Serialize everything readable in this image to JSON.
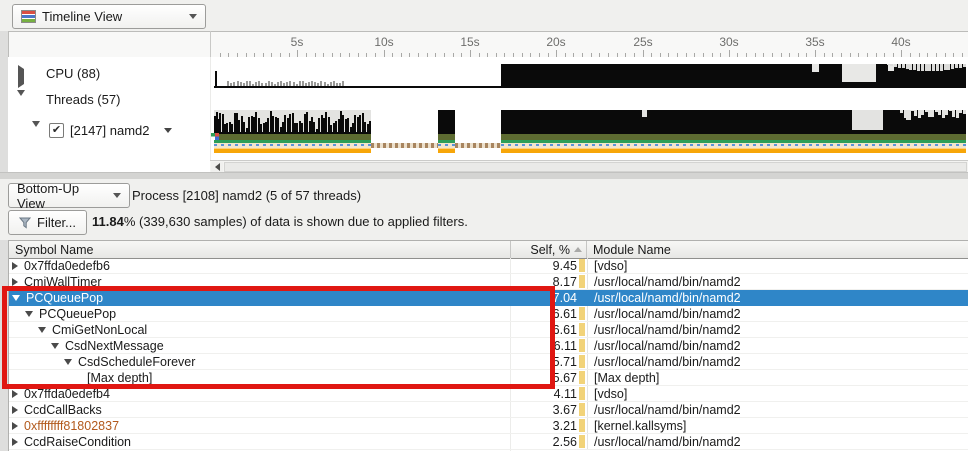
{
  "toolbar": {
    "view_selector": "Timeline View"
  },
  "timeline": {
    "ruler_labels": [
      "5s",
      "10s",
      "15s",
      "20s",
      "25s",
      "30s",
      "35s",
      "40s"
    ],
    "ruler_major_s": 5,
    "ruler_minor_s": 0.5,
    "ruler_end_s": 43.8,
    "tree": {
      "cpu_label": "CPU (88)",
      "threads_label": "Threads (57)",
      "thread_label": "[2147] namd2",
      "thread_checked": true
    },
    "cpu_segments": [
      {
        "type": "sparse",
        "from": 0.25,
        "to": 16.85
      },
      {
        "type": "solid",
        "from": 16.85,
        "to": 43.8
      }
    ],
    "cpu_notches": [
      {
        "from": 34.9,
        "to": 35.3,
        "depth": 0.35
      },
      {
        "from": 36.6,
        "to": 38.6,
        "depth": 0.75
      },
      {
        "from": 39.3,
        "to": 39.6,
        "depth": 0.3
      }
    ],
    "thread_segments": [
      {
        "type": "bars",
        "from": 0.25,
        "to": 9.3
      },
      {
        "type": "gap",
        "from": 9.3,
        "to": 13.2
      },
      {
        "type": "solid",
        "from": 13.2,
        "to": 14.2
      },
      {
        "type": "gap",
        "from": 14.2,
        "to": 16.85
      },
      {
        "type": "solid",
        "from": 16.85,
        "to": 43.8
      }
    ],
    "thread_notches": [
      {
        "from": 25.0,
        "to": 25.3,
        "depth": 0.3
      },
      {
        "from": 37.2,
        "to": 39.0,
        "depth": 0.85
      },
      {
        "from": 40.3,
        "to": 40.6,
        "depth": 0.4
      }
    ]
  },
  "bottom": {
    "view_selector": "Bottom-Up View",
    "process_label": "Process [2108] namd2 (5 of 57 threads)",
    "filter_button": "Filter...",
    "filter_stat_bold": "11.84",
    "filter_stat_rest": "% (339,630 samples) of data is shown due to applied filters."
  },
  "table": {
    "columns": {
      "symbol": "Symbol Name",
      "self": "Self, %",
      "module": "Module Name"
    },
    "rows": [
      {
        "symbol": "0x7ffda0edefb6",
        "self": "9.45",
        "module": "[vdso]",
        "depth": 0,
        "expander": "collapsed",
        "selected": false,
        "kernel": false
      },
      {
        "symbol": "CmiWallTimer",
        "self": "8.17",
        "module": "/usr/local/namd/bin/namd2",
        "depth": 0,
        "expander": "collapsed",
        "selected": false,
        "kernel": false
      },
      {
        "symbol": "PCQueuePop",
        "self": "7.04",
        "module": "/usr/local/namd/bin/namd2",
        "depth": 0,
        "expander": "expanded",
        "selected": true,
        "kernel": false
      },
      {
        "symbol": "PCQueuePop",
        "self": "6.61",
        "module": "/usr/local/namd/bin/namd2",
        "depth": 1,
        "expander": "expanded",
        "selected": false,
        "kernel": false
      },
      {
        "symbol": "CmiGetNonLocal",
        "self": "6.61",
        "module": "/usr/local/namd/bin/namd2",
        "depth": 2,
        "expander": "expanded",
        "selected": false,
        "kernel": false
      },
      {
        "symbol": "CsdNextMessage",
        "self": "6.11",
        "module": "/usr/local/namd/bin/namd2",
        "depth": 3,
        "expander": "expanded",
        "selected": false,
        "kernel": false
      },
      {
        "symbol": "CsdScheduleForever",
        "self": "5.71",
        "module": "/usr/local/namd/bin/namd2",
        "depth": 4,
        "expander": "expanded",
        "selected": false,
        "kernel": false
      },
      {
        "symbol": "[Max depth]",
        "self": "5.67",
        "module": "[Max depth]",
        "depth": 5,
        "expander": "none",
        "selected": false,
        "kernel": false
      },
      {
        "symbol": "0x7ffda0edefb4",
        "self": "4.11",
        "module": "[vdso]",
        "depth": 0,
        "expander": "collapsed",
        "selected": false,
        "kernel": false
      },
      {
        "symbol": "CcdCallBacks",
        "self": "3.67",
        "module": "/usr/local/namd/bin/namd2",
        "depth": 0,
        "expander": "collapsed",
        "selected": false,
        "kernel": false
      },
      {
        "symbol": "0xffffffff81802837",
        "self": "3.21",
        "module": "[kernel.kallsyms]",
        "depth": 0,
        "expander": "collapsed",
        "selected": false,
        "kernel": true
      },
      {
        "symbol": "CcdRaiseCondition",
        "self": "2.56",
        "module": "/usr/local/namd/bin/namd2",
        "depth": 0,
        "expander": "collapsed",
        "selected": false,
        "kernel": false
      }
    ]
  },
  "annotation": {
    "type": "highlight-rectangle",
    "color": "#e01712"
  },
  "colors": {
    "selection_blue": "#2f86c8",
    "self_bar_yellow": "#f2d379",
    "kernel_symbol": "#b2591c",
    "band_olive": "#5d6b31",
    "band_green": "#2d9e57",
    "band_tan": "#f2e5cd",
    "band_blue_dash": "#5b93d8",
    "band_brown_dot": "#a8855f",
    "band_orange": "#f7a609",
    "hist_bg_gray": "#e3e3e1"
  }
}
